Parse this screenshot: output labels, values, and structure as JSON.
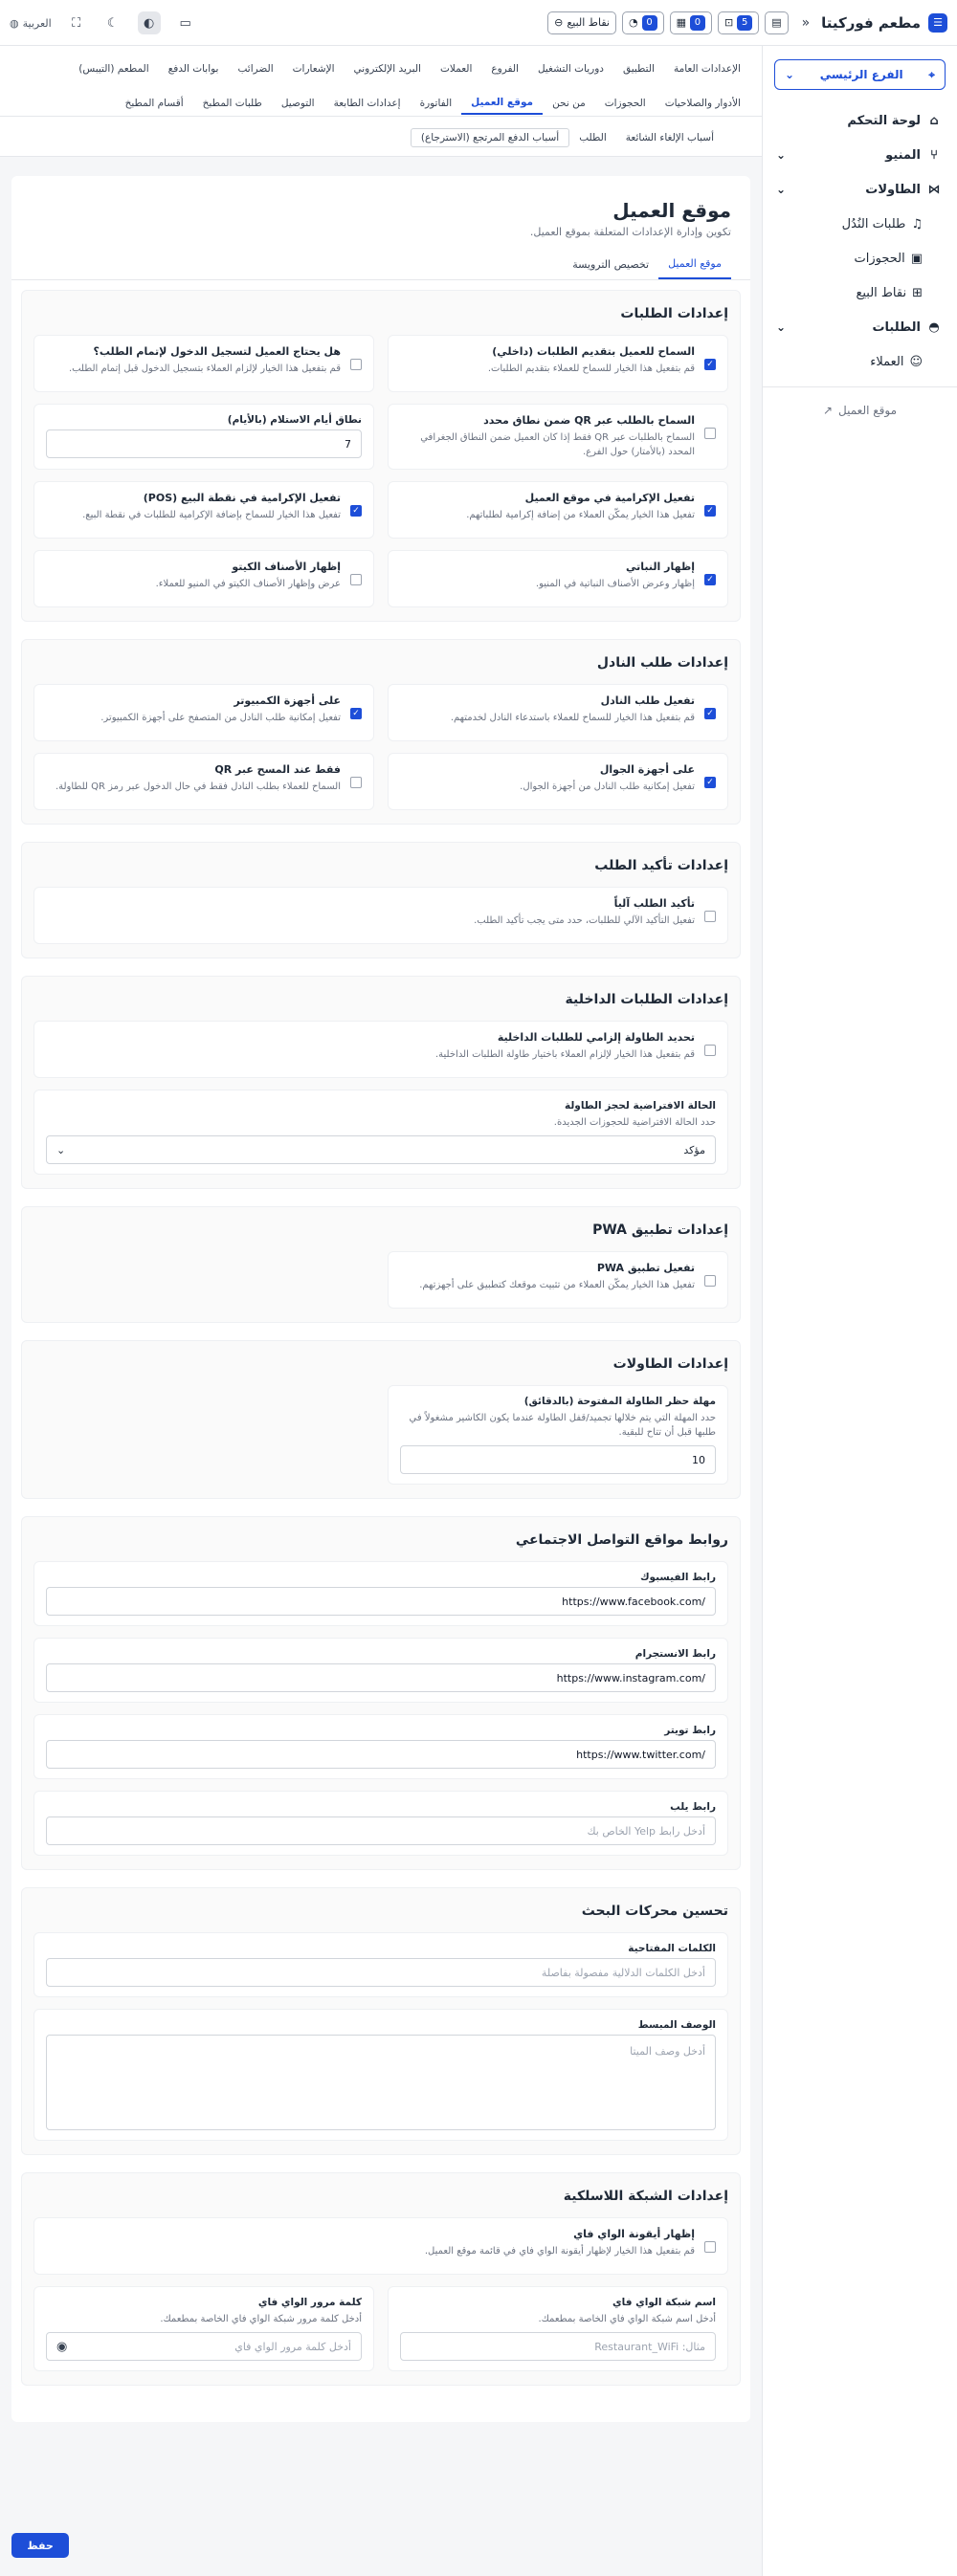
{
  "brand": {
    "name": "مطعم فوركيتا"
  },
  "topbar": {
    "pos_label": "نقاط البيع",
    "badges": [
      "0",
      "0",
      "5"
    ],
    "lang_label": "العربية"
  },
  "sidebar": {
    "branch": "الفرع الرئيسي",
    "items": [
      {
        "label": "لوحة التحكم"
      },
      {
        "label": "المنيو"
      },
      {
        "label": "الطاولات"
      },
      {
        "label": "طلبات النُدُل"
      },
      {
        "label": "الحجوزات"
      },
      {
        "label": "نقاط البيع"
      },
      {
        "label": "الطلبات"
      },
      {
        "label": "العملاء"
      }
    ],
    "customer_site": "موقع العميل"
  },
  "tabs": {
    "row1": [
      "الإعدادات العامة",
      "التطبيق",
      "دوريات التشغيل",
      "الفروع",
      "العملات",
      "البريد الإلكتروني",
      "الإشعارات",
      "الضرائب",
      "بوابات الدفع",
      "المطعم (التيبس)"
    ],
    "row2": [
      "الأدوار والصلاحيات",
      "الحجوزات",
      "من نحن",
      "موقع العميل",
      "الفاتورة",
      "إعدادات الطابعة",
      "التوصيل",
      "طلبات المطبخ",
      "أقسام المطبخ"
    ],
    "row3": [
      "أسباب الإلغاء الشائعة",
      "الطلب",
      "أسباب الدفع المرتجع (الاسترجاع)"
    ]
  },
  "page": {
    "title": "موقع العميل",
    "subtitle": "تكوين وإدارة الإعدادات المتعلقة بموقع العميل.",
    "inner_tabs": [
      "موقع العميل",
      "تخصيص الترويسة"
    ]
  },
  "orders": {
    "title": "إعدادات الطلبات",
    "allow_orders_title": "السماح للعميل بتقديم الطلبات (داخلي)",
    "allow_orders_desc": "قم بتفعيل هذا الخيار للسماح للعملاء بتقديم الطلبات.",
    "need_login_title": "هل يحتاج العميل لتسجيل الدخول لإتمام الطلب؟",
    "need_login_desc": "قم بتفعيل هذا الخيار لإلزام العملاء بتسجيل الدخول قبل إتمام الطلب.",
    "qr_range_title": "السماح بالطلب عبر QR ضمن نطاق محدد",
    "qr_range_desc": "السماح بالطلبات عبر QR فقط إذا كان العميل ضمن النطاق الجغرافي المحدد (بالأمتار) حول الفرع.",
    "range_label": "نطاق أيام الاستلام (بالأيام)",
    "range_value": "7",
    "tip_site_title": "تفعيل الإكرامية في موقع العميل",
    "tip_site_desc": "تفعيل هذا الخيار يمكّن العملاء من إضافة إكرامية لطلباتهم.",
    "tip_pos_title": "تفعيل الإكرامية في نقطة البيع (POS)",
    "tip_pos_desc": "تفعيل هذا الخيار للسماح بإضافة الإكرامية للطلبات في نقطة البيع.",
    "veg_title": "إظهار النباتي",
    "veg_desc": "إظهار وعرض الأصناف النباتية في المنيو.",
    "keto_title": "إظهار الأصناف الكيتو",
    "keto_desc": "عرض وإظهار الأصناف الكيتو في المنيو للعملاء."
  },
  "waiter": {
    "title": "إعدادات طلب النادل",
    "enable_title": "تفعيل طلب النادل",
    "enable_desc": "قم بتفعيل هذا الخيار للسماح للعملاء باستدعاء النادل لخدمتهم.",
    "desktop_title": "على أجهزة الكمبيوتر",
    "desktop_desc": "تفعيل إمكانية طلب النادل من المتصفح على أجهزة الكمبيوتر.",
    "mobile_title": "على أجهزة الجوال",
    "mobile_desc": "تفعيل إمكانية طلب النادل من أجهزة الجوال.",
    "qr_title": "فقط عند المسح عبر QR",
    "qr_desc": "السماح للعملاء بطلب النادل فقط في حال الدخول عبر رمز QR للطاولة."
  },
  "confirm": {
    "title": "إعدادات تأكيد الطلب",
    "auto_title": "تأكيد الطلب آلياً",
    "auto_desc": "تفعيل التأكيد الآلي للطلبات، حدد متى يجب تأكيد الطلب."
  },
  "dinein": {
    "title": "إعدادات الطلبات الداخلية",
    "table_title": "تحديد الطاولة إلزامي للطلبات الداخلية",
    "table_desc": "قم بتفعيل هذا الخيار لإلزام العملاء باختيار طاولة الطلبات الداخلية.",
    "status_label": "الحالة الافتراضية لحجز الطاولة",
    "status_desc": "حدد الحالة الافتراضية للحجوزات الجديدة.",
    "status_value": "مؤكد"
  },
  "pwa": {
    "title": "إعدادات تطبيق PWA",
    "enable_title": "تفعيل تطبيق PWA",
    "enable_desc": "تفعيل هذا الخيار يمكّن العملاء من تثبيت موقعك كتطبيق على أجهزتهم."
  },
  "tables": {
    "title": "إعدادات الطاولات",
    "lock_label": "مهلة حظر الطاولة المفتوحة (بالدقائق)",
    "lock_desc": "حدد المهلة التي يتم خلالها تجميد/قفل الطاولة عندما يكون الكاشير مشغولاً في طلبها قبل أن تتاح للبقية.",
    "lock_value": "10"
  },
  "social": {
    "title": "روابط مواقع التواصل الاجتماعي",
    "facebook_label": "رابط الفيسبوك",
    "facebook_value": "https://www.facebook.com/",
    "instagram_label": "رابط الانستجرام",
    "instagram_value": "https://www.instagram.com/",
    "twitter_label": "رابط تويتر",
    "twitter_value": "https://www.twitter.com/",
    "yelp_label": "رابط يلب",
    "yelp_placeholder": "أدخل رابط Yelp الخاص بك"
  },
  "seo": {
    "title": "تحسين محركات البحث",
    "keywords_label": "الكلمات المفتاحية",
    "keywords_placeholder": "أدخل الكلمات الدلالية مفصولة بفاصلة",
    "desc_label": "الوصف المبسط",
    "desc_placeholder": "أدخل وصف الميتا"
  },
  "wifi": {
    "title": "إعدادات الشبكة اللاسلكية",
    "show_title": "إظهار أيقونة الواي فاي",
    "show_desc": "قم بتفعيل هذا الخيار لإظهار أيقونة الواي فاي في قائمة موقع العميل.",
    "name_label": "اسم شبكة الواي فاي",
    "name_desc": "أدخل اسم شبكة الواي فاي الخاصة بمطعمك.",
    "name_placeholder": "مثال: Restaurant_WiFi",
    "pass_label": "كلمة مرور الواي فاي",
    "pass_desc": "أدخل كلمة مرور شبكة الواي فاي الخاصة بمطعمك.",
    "pass_placeholder": "أدخل كلمة مرور الواي فاي"
  },
  "save_label": "حفظ"
}
